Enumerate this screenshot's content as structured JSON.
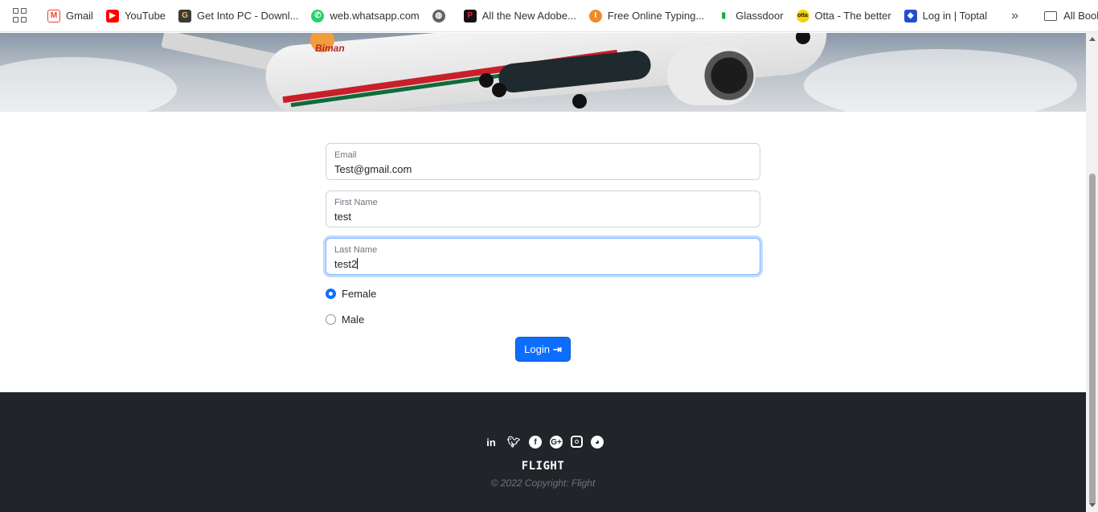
{
  "bookmarks": {
    "items": [
      {
        "label": "Gmail",
        "icon": "gmail-icon",
        "color": "#ea4335"
      },
      {
        "label": "YouTube",
        "icon": "youtube-icon",
        "color": "#ff0000"
      },
      {
        "label": "Get Into PC - Downl...",
        "icon": "getintopc-icon",
        "color": "#3a3a3a"
      },
      {
        "label": "web.whatsapp.com",
        "icon": "whatsapp-icon",
        "color": "#25d366"
      },
      {
        "label": "",
        "icon": "globe-icon",
        "color": "#5f6368"
      },
      {
        "label": "All the New Adobe...",
        "icon": "adobe-icon",
        "color": "#111111"
      },
      {
        "label": "Free Online Typing...",
        "icon": "typing-icon",
        "color": "#f08a24"
      },
      {
        "label": "Glassdoor",
        "icon": "glassdoor-icon",
        "color": "#0caa41"
      },
      {
        "label": "Otta - The better",
        "icon": "otta-icon",
        "color": "#f5d20c"
      },
      {
        "label": "Log in | Toptal",
        "icon": "toptal-icon",
        "color": "#204ecf"
      }
    ],
    "more": "»",
    "all_bookmarks": "All Bookmarks"
  },
  "hero": {
    "livery_text": "Biman"
  },
  "form": {
    "email": {
      "label": "Email",
      "value": "Test@gmail.com"
    },
    "first_name": {
      "label": "First Name",
      "value": "test"
    },
    "last_name": {
      "label": "Last Name",
      "value": "test2"
    },
    "gender_options": [
      {
        "label": "Female",
        "checked": true
      },
      {
        "label": "Male",
        "checked": false
      }
    ],
    "submit_label": "Login"
  },
  "footer": {
    "social": [
      "linkedin-icon",
      "twitter-icon",
      "facebook-icon",
      "google-plus-icon",
      "instagram-icon",
      "github-icon"
    ],
    "brand": "FLIGHT",
    "copyright": "© 2022 Copyright: Flight"
  },
  "colors": {
    "primary": "#0d6efd",
    "footer_bg": "#212529"
  }
}
